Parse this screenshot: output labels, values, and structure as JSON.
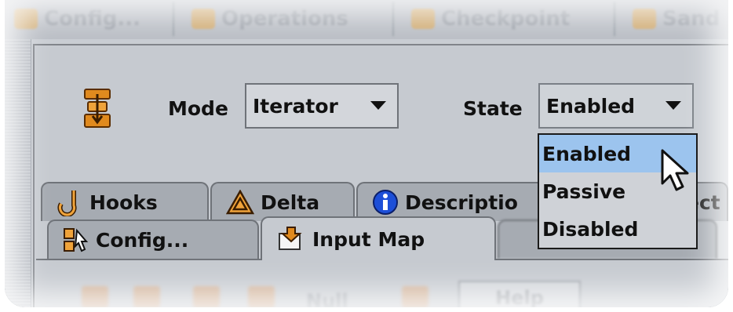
{
  "top_tabs": [
    {
      "label": "Config...",
      "icon": "config-icon"
    },
    {
      "label": "Operations",
      "icon": "operations-icon"
    },
    {
      "label": "Checkpoint",
      "icon": "checkpoint-icon"
    },
    {
      "label": "Sand",
      "icon": "sandbox-icon"
    }
  ],
  "form": {
    "mode_label": "Mode",
    "mode_value": "Iterator",
    "state_label": "State",
    "state_value": "Enabled"
  },
  "state_dropdown": {
    "options": [
      "Enabled",
      "Passive",
      "Disabled"
    ],
    "highlighted": "Enabled"
  },
  "tabs_row1": [
    {
      "label": "Hooks",
      "icon": "hook-icon"
    },
    {
      "label": "Delta",
      "icon": "warning-delta-icon"
    },
    {
      "label": "Descriptio",
      "icon": "info-icon"
    },
    {
      "label": "ect"
    }
  ],
  "tabs_row2": [
    {
      "label": "Config...",
      "icon": "config-icon"
    },
    {
      "label": "Input Map",
      "icon": "input-map-icon",
      "active": true
    }
  ],
  "toolbar": {
    "null_label": "Null",
    "help_label": "Help"
  },
  "colors": {
    "panel_bg": "#c6cad0",
    "selection": "#9cc4ee",
    "info_blue": "#1d4fd8",
    "icon_orange": "#e08a1e"
  }
}
